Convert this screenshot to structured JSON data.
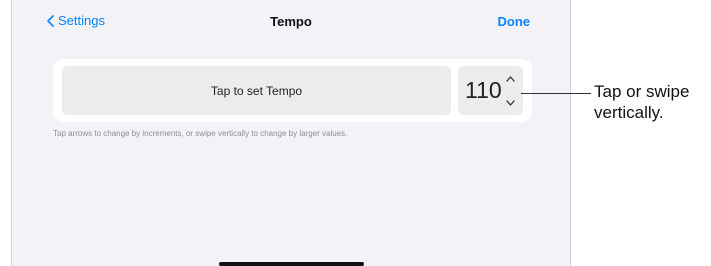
{
  "navbar": {
    "back_label": "Settings",
    "title": "Tempo",
    "done_label": "Done"
  },
  "tempo": {
    "tap_label": "Tap to set Tempo",
    "value": "110"
  },
  "hint_text": "Tap arrows to change by increments, or swipe vertically to change by larger values.",
  "callout": {
    "line1": "Tap or swipe",
    "line2": "vertically."
  },
  "colors": {
    "accent": "#0a84ff",
    "background": "#f2f2f7",
    "card": "#ffffff",
    "control": "#ececee"
  },
  "icons": {
    "back": "chevron-left-icon",
    "increment": "chevron-up-icon",
    "decrement": "chevron-down-icon"
  }
}
